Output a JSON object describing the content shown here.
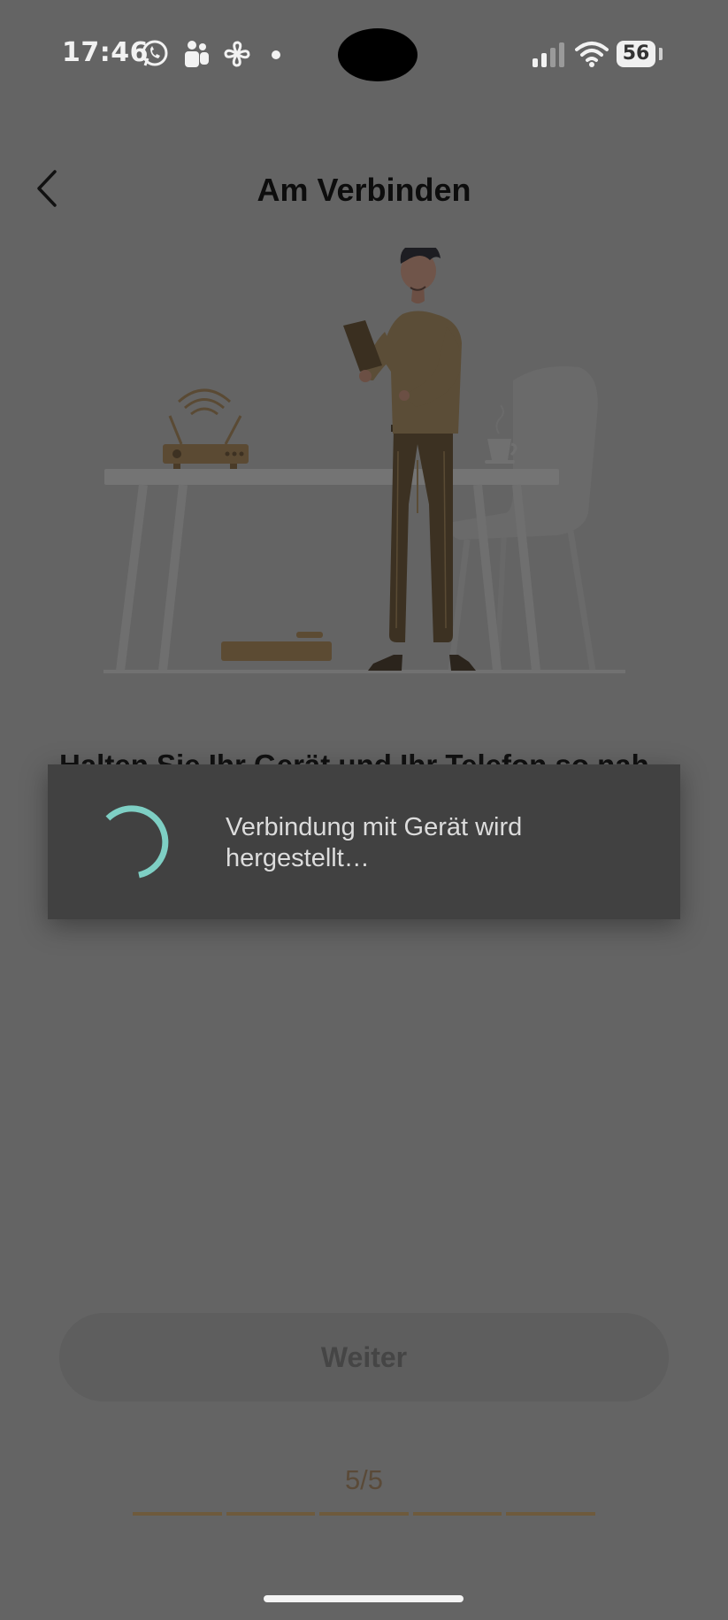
{
  "status_bar": {
    "time": "17:46",
    "battery": "56",
    "icons": [
      "whatsapp-icon",
      "teams-icon",
      "pinwheel-icon",
      "dot-icon",
      "signal-icon",
      "wifi-icon",
      "battery-icon"
    ]
  },
  "header": {
    "title": "Am Verbinden",
    "back_icon": "chevron-left-icon"
  },
  "content": {
    "instruction": "Halten Sie Ihr Gerät und Ihr Telefon so nah"
  },
  "dialog": {
    "message": "Verbindung mit Gerät wird hergestellt…",
    "spinner_color": "#7ecfc4"
  },
  "footer": {
    "next_label": "Weiter",
    "step_indicator": "5/5",
    "step_segments": 5,
    "accent_color": "#6e5a3c"
  }
}
